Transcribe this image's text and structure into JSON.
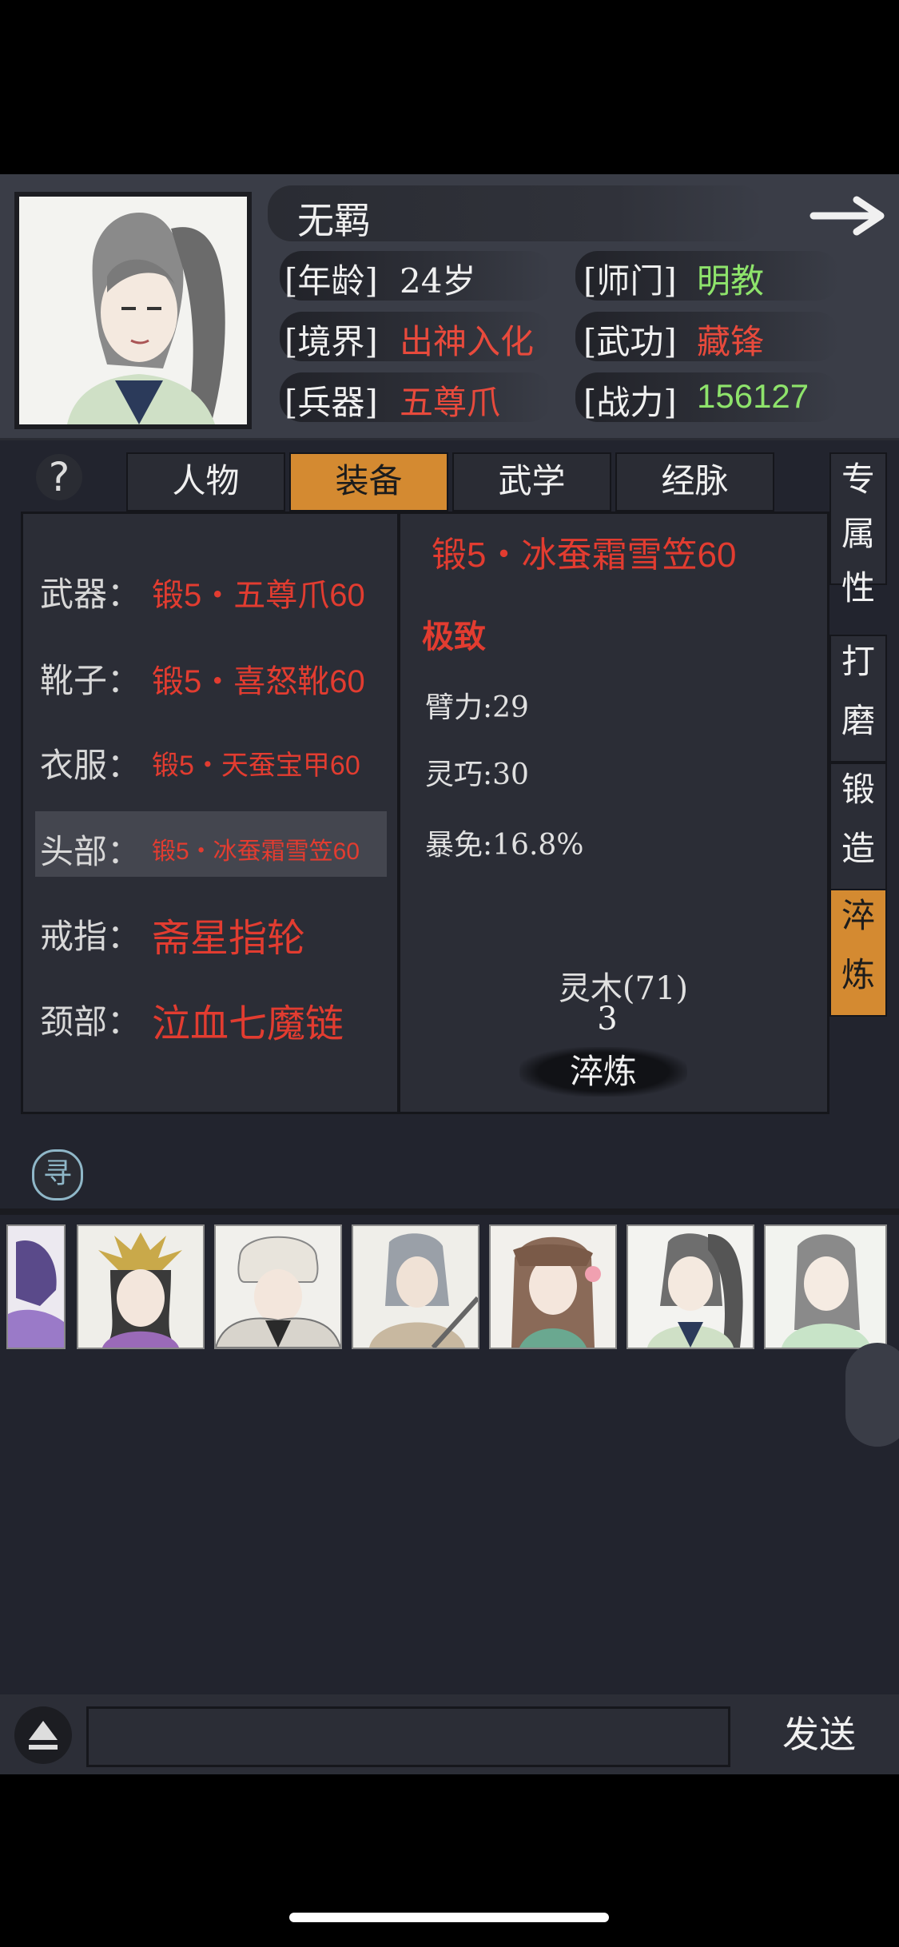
{
  "profile": {
    "name": "无羁",
    "rows": [
      {
        "label": "[年龄]",
        "value": "24岁"
      },
      {
        "label": "[境界]",
        "value": "出神入化"
      },
      {
        "label": "[兵器]",
        "value": "五尊爪"
      },
      {
        "label": "[师门]",
        "value": "明教"
      },
      {
        "label": "[武功]",
        "value": "藏锋"
      },
      {
        "label": "[战力]",
        "value": "156127"
      }
    ]
  },
  "tabs": [
    {
      "label": "人物"
    },
    {
      "label": "装备"
    },
    {
      "label": "武学"
    },
    {
      "label": "经脉"
    }
  ],
  "help_icon": "?",
  "equipment": [
    {
      "slot": "武器：",
      "item": "锻5・五尊爪60"
    },
    {
      "slot": "靴子：",
      "item": "锻5・喜怒靴60"
    },
    {
      "slot": "衣服：",
      "item": "锻5・天蚕宝甲60"
    },
    {
      "slot": "头部：",
      "item": "锻5・冰蚕霜雪笠60"
    },
    {
      "slot": "戒指：",
      "item": "斋星指轮"
    },
    {
      "slot": "颈部：",
      "item": "泣血七魔链"
    }
  ],
  "detail": {
    "title": "锻5・冰蚕霜雪笠60",
    "grade": "极致",
    "stats": [
      "臂力:29",
      "灵巧:30",
      "暴免:16.8%"
    ],
    "material": "灵木(71)",
    "material_count": "3",
    "action": "淬炼"
  },
  "side_tabs": [
    {
      "chars": [
        "专",
        "属",
        "性"
      ]
    },
    {
      "chars": [
        "打",
        "磨"
      ]
    },
    {
      "chars": [
        "锻",
        "造"
      ]
    },
    {
      "chars": [
        "淬",
        "炼"
      ]
    }
  ],
  "seek_icon": "寻",
  "chat": {
    "send": "发送"
  },
  "colors": {
    "active": "#d48a31",
    "red": "#e23c30",
    "green": "#8ee36b",
    "bg": "#22242e"
  }
}
